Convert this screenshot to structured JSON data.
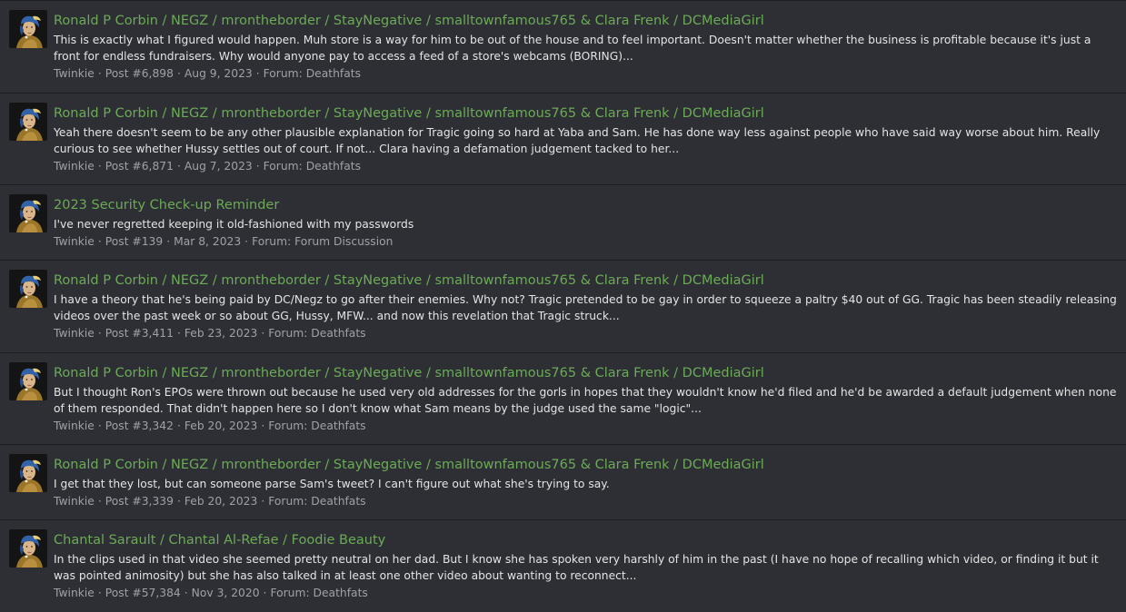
{
  "results": [
    {
      "title": "Ronald P Corbin / NEGZ / mrontheborder / StayNegative / smalltownfamous765 & Clara Frenk / DCMediaGirl",
      "snippet": "This is exactly what I figured would happen. Muh store is a way for him to be out of the house and to feel important. Doesn't matter whether the business is profitable because it's just a front for endless fundraisers. Why would anyone pay to access a feed of a store's webcams (BORING)...",
      "author": "Twinkie",
      "post": "Post #6,898",
      "date": "Aug 9, 2023",
      "forum_label": "Forum:",
      "forum": "Deathfats"
    },
    {
      "title": "Ronald P Corbin / NEGZ / mrontheborder / StayNegative / smalltownfamous765 & Clara Frenk / DCMediaGirl",
      "snippet": "Yeah there doesn't seem to be any other plausible explanation for Tragic going so hard at Yaba and Sam. He has done way less against people who have said way worse about him. Really curious to see whether Hussy settles out of court. If not... Clara having a defamation judgement tacked to her...",
      "author": "Twinkie",
      "post": "Post #6,871",
      "date": "Aug 7, 2023",
      "forum_label": "Forum:",
      "forum": "Deathfats"
    },
    {
      "title": "2023 Security Check-up Reminder",
      "snippet": "I've never regretted keeping it old-fashioned with my passwords",
      "author": "Twinkie",
      "post": "Post #139",
      "date": "Mar 8, 2023",
      "forum_label": "Forum:",
      "forum": "Forum Discussion"
    },
    {
      "title": "Ronald P Corbin / NEGZ / mrontheborder / StayNegative / smalltownfamous765 & Clara Frenk / DCMediaGirl",
      "snippet": "I have a theory that he's being paid by DC/Negz to go after their enemies. Why not? Tragic pretended to be gay in order to squeeze a paltry $40 out of GG. Tragic has been steadily releasing videos over the past week or so about GG, Hussy, MFW... and now this revelation that Tragic struck...",
      "author": "Twinkie",
      "post": "Post #3,411",
      "date": "Feb 23, 2023",
      "forum_label": "Forum:",
      "forum": "Deathfats"
    },
    {
      "title": "Ronald P Corbin / NEGZ / mrontheborder / StayNegative / smalltownfamous765 & Clara Frenk / DCMediaGirl",
      "snippet": "But I thought Ron's EPOs were thrown out because he used very old addresses for the gorls in hopes that they wouldn't know he'd filed and he'd be awarded a default judgement when none of them responded. That didn't happen here so I don't know what Sam means by the judge used the same \"logic\"...",
      "author": "Twinkie",
      "post": "Post #3,342",
      "date": "Feb 20, 2023",
      "forum_label": "Forum:",
      "forum": "Deathfats"
    },
    {
      "title": "Ronald P Corbin / NEGZ / mrontheborder / StayNegative / smalltownfamous765 & Clara Frenk / DCMediaGirl",
      "snippet": "I get that they lost, but can someone parse Sam's tweet? I can't figure out what she's trying to say.",
      "author": "Twinkie",
      "post": "Post #3,339",
      "date": "Feb 20, 2023",
      "forum_label": "Forum:",
      "forum": "Deathfats"
    },
    {
      "title": "Chantal Sarault / Chantal Al-Refae / Foodie Beauty",
      "snippet": "In the clips used in that video she seemed pretty neutral on her dad. But I know she has spoken very harshly of him in the past (I have no hope of recalling which video, or finding it but it was pointed animosity) but she has also talked in at least one other video about wanting to reconnect...",
      "author": "Twinkie",
      "post": "Post #57,384",
      "date": "Nov 3, 2020",
      "forum_label": "Forum:",
      "forum": "Deathfats"
    }
  ],
  "avatar_icon": "girl-with-pearl-earring-avatar-icon",
  "colors": {
    "background": "#2d2f35",
    "title": "#6bab55",
    "snippet": "#e4e4e4",
    "meta": "#a0a1a6",
    "divider": "#1c1d21"
  }
}
